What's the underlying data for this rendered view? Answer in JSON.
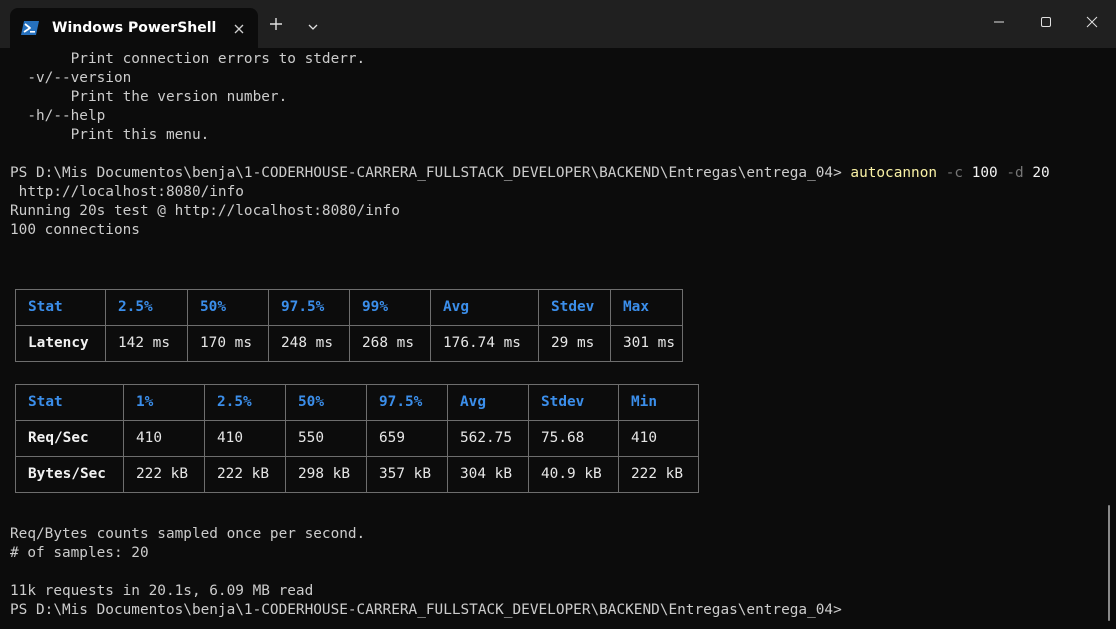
{
  "window": {
    "tab_title": "Windows PowerShell",
    "accent_color": "#3b8eea"
  },
  "terminal": {
    "help_lines": [
      "       Print connection errors to stderr.",
      "  -v/--version",
      "       Print the version number.",
      "  -h/--help",
      "       Print this menu."
    ],
    "prompt": "PS D:\\Mis Documentos\\benja\\1-CODERHOUSE-CARRERA_FULLSTACK_DEVELOPER\\BACKEND\\Entregas\\entrega_04> ",
    "command": {
      "name": "autocannon",
      "flag_c": "-c",
      "value_c": "100",
      "flag_d": "-d",
      "value_d": "20",
      "url": " http://localhost:8080/info"
    },
    "running_line": "Running 20s test @ http://localhost:8080/info",
    "connections_line": "100 connections",
    "latency_table": {
      "headers": [
        "Stat",
        "2.5%",
        "50%",
        "97.5%",
        "99%",
        "Avg",
        "Stdev",
        "Max"
      ],
      "rows": [
        [
          "Latency",
          "142 ms",
          "170 ms",
          "248 ms",
          "268 ms",
          "176.74 ms",
          "29 ms",
          "301 ms"
        ]
      ]
    },
    "throughput_table": {
      "headers": [
        "Stat",
        "1%",
        "2.5%",
        "50%",
        "97.5%",
        "Avg",
        "Stdev",
        "Min"
      ],
      "rows": [
        [
          "Req/Sec",
          "410",
          "410",
          "550",
          "659",
          "562.75",
          "75.68",
          "410"
        ],
        [
          "Bytes/Sec",
          "222 kB",
          "222 kB",
          "298 kB",
          "357 kB",
          "304 kB",
          "40.9 kB",
          "222 kB"
        ]
      ]
    },
    "sample_note": "Req/Bytes counts sampled once per second.",
    "samples_line": "# of samples: 20",
    "summary_line": "11k requests in 20.1s, 6.09 MB read",
    "final_prompt": "PS D:\\Mis Documentos\\benja\\1-CODERHOUSE-CARRERA_FULLSTACK_DEVELOPER\\BACKEND\\Entregas\\entrega_04>"
  },
  "icons": {
    "tab_icon": "powershell-icon",
    "tab_close": "close-icon",
    "new_tab": "plus-icon",
    "dropdown": "chevron-down-icon",
    "minimize": "minimize-icon",
    "maximize": "maximize-icon",
    "close": "close-icon"
  }
}
